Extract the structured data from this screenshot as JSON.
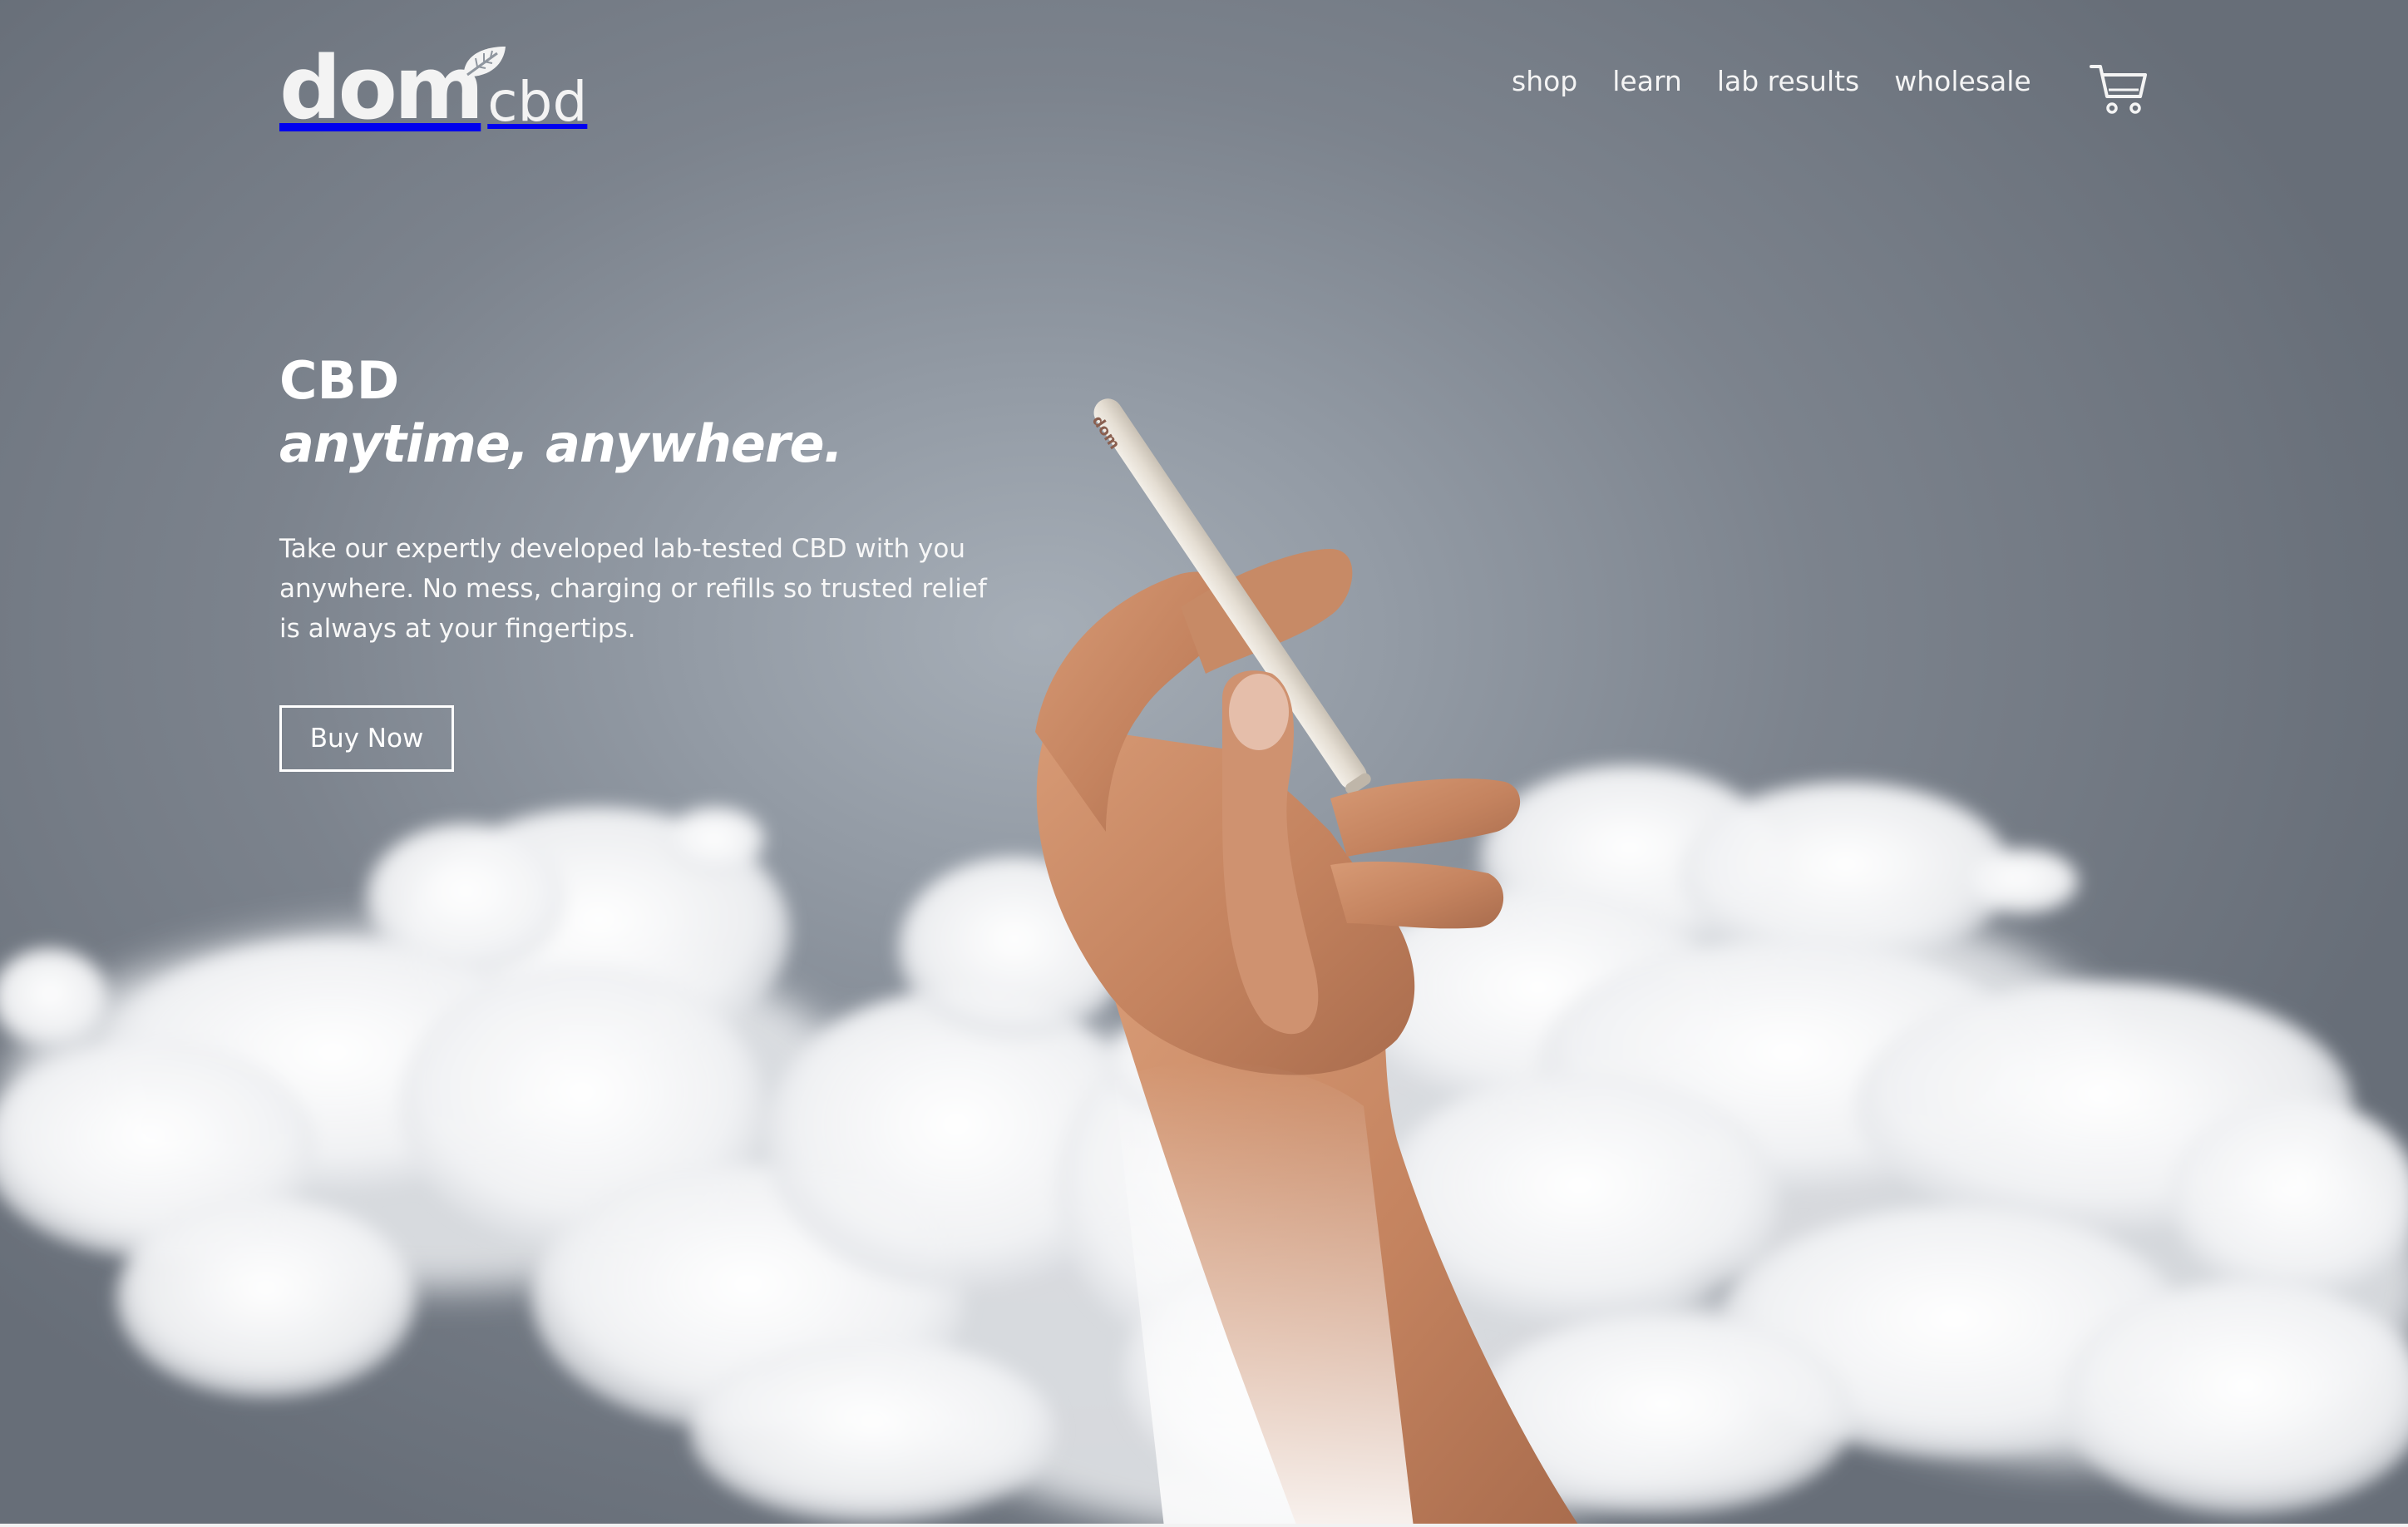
{
  "brand": {
    "logo_primary": "dom",
    "logo_secondary": "cbd"
  },
  "nav": {
    "items": [
      {
        "label": "shop"
      },
      {
        "label": "learn"
      },
      {
        "label": "lab results"
      },
      {
        "label": "wholesale"
      }
    ],
    "cart_icon": "shopping-cart-icon"
  },
  "hero": {
    "title_line1": "CBD",
    "title_line2": "anytime, anywhere.",
    "description": "Take our expertly developed lab-tested CBD with you anywhere. No mess, charging or refills so trusted relief is always at your fingertips.",
    "cta_label": "Buy Now",
    "product_imprint": "dom"
  },
  "colors": {
    "background": "#7c838d",
    "text": "#ffffff",
    "cloud": "#ffffff",
    "product": "#e3ddd3",
    "skin": "#c98a67"
  }
}
